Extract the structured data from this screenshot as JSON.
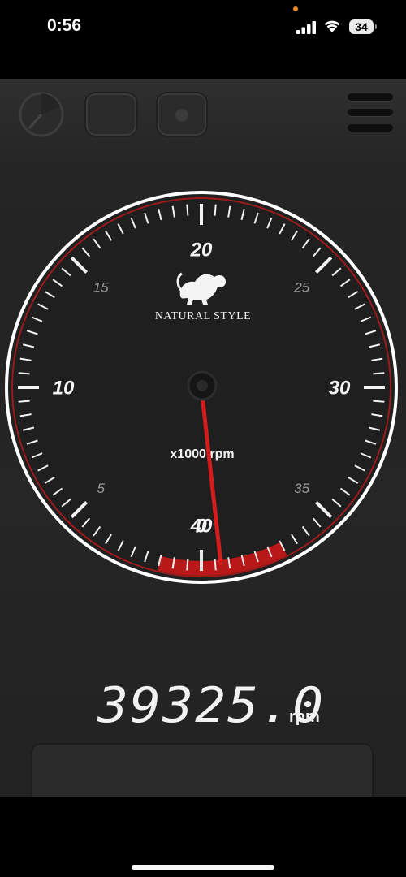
{
  "status_bar": {
    "time": "0:56",
    "battery": "34"
  },
  "toolbar": {
    "buttons": [
      "gauge-icon",
      "stop-icon",
      "record-icon",
      "menu-icon"
    ]
  },
  "gauge": {
    "brand": "NATURAL STYLE",
    "unit_label": "x1000 rpm",
    "major_labels": [
      "0",
      "10",
      "20",
      "30",
      "40"
    ],
    "minor_labels": [
      "5",
      "15",
      "25",
      "35"
    ],
    "min": 0,
    "max": 41.5,
    "redline_start": 37,
    "needle_value": 39.3,
    "colors": {
      "ring": "#ffffff",
      "redline": "#c01818",
      "needle": "#d41c1c",
      "face": "#1f1f1f"
    }
  },
  "readout": {
    "value": "39325.0",
    "unit": "rpm"
  }
}
